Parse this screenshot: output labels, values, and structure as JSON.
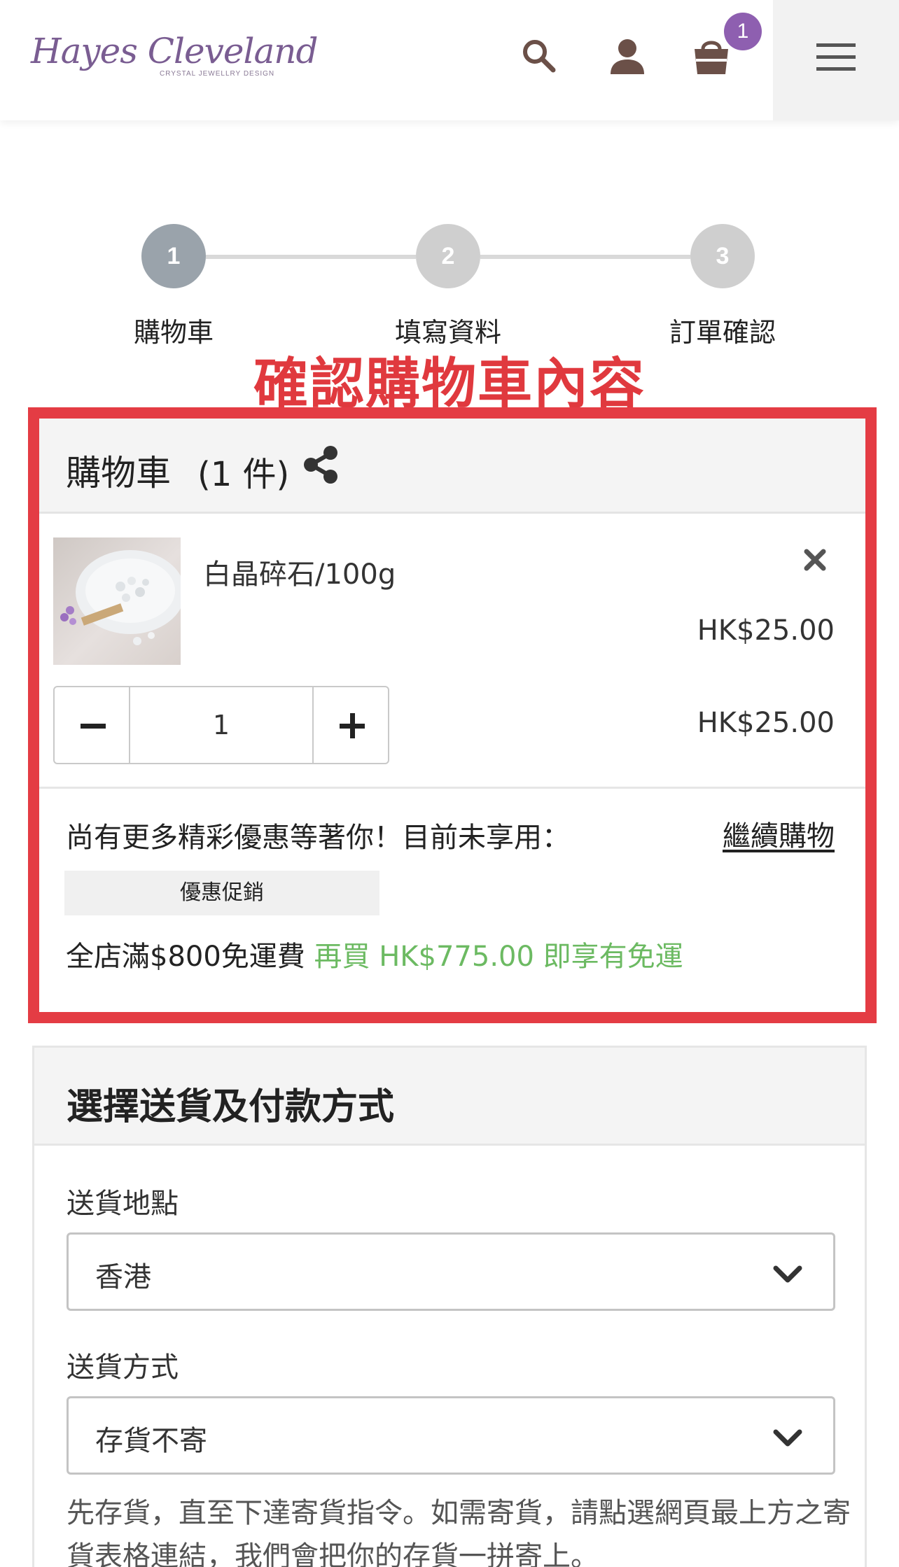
{
  "header": {
    "logo_text": "Hayes Cleveland",
    "logo_sub": "CRYSTAL JEWELLRY DESIGN",
    "cart_badge": "1",
    "icons": [
      "search-icon",
      "user-icon",
      "shopping-bag-icon",
      "hamburger-menu-icon"
    ]
  },
  "steps": [
    {
      "number": "1",
      "label": "購物車",
      "state": "active"
    },
    {
      "number": "2",
      "label": "填寫資料",
      "state": "inactive"
    },
    {
      "number": "3",
      "label": "訂單確認",
      "state": "inactive"
    }
  ],
  "annotation": "確認購物車內容",
  "cart": {
    "title": "購物車",
    "count": "(1 件)",
    "item": {
      "name": "白晶碎石/100g",
      "unit_price": "HK$25.00",
      "quantity": "1",
      "line_total": "HK$25.00"
    },
    "promo_text": "尚有更多精彩優惠等著你！目前未享用：",
    "continue_link": "繼續購物",
    "promo_badge": "優惠促銷",
    "free_shipping_text": "全店滿$800免運費",
    "free_shipping_hint": "再買 HK$775.00 即享有免運"
  },
  "shipping": {
    "title": "選擇送貨及付款方式",
    "location_label": "送貨地點",
    "location_value": "香港",
    "method_label": "送貨方式",
    "method_value": "存貨不寄",
    "note": "先存貨，直至下達寄貨指令。如需寄貨，請點選網頁最上方之寄貨表格連結，我們會把你的存貨一拼寄上。"
  },
  "colors": {
    "brand_purple": "#8e5fb0",
    "annotation_red": "#e43c44",
    "hint_green": "#6cba62",
    "icon_brown": "#6b5048"
  }
}
